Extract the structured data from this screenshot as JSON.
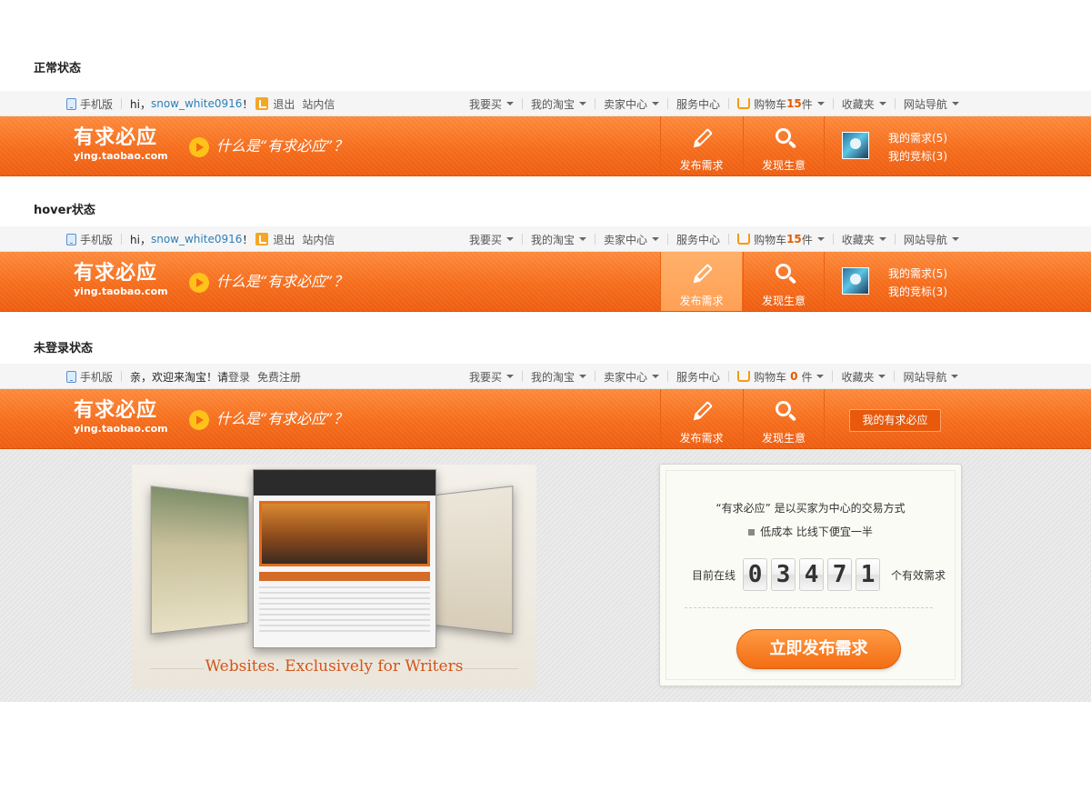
{
  "labels": {
    "normal": "正常状态",
    "hover": "hover状态",
    "logged_out": "未登录状态"
  },
  "topbar": {
    "mobile": "手机版",
    "hi": "hi，",
    "username": "snow_white0916",
    "exclaim": "！",
    "logout": "退出",
    "inbox": "站内信",
    "guest_greeting": "亲，欢迎来淘宝！请",
    "login": "登录",
    "register": "免费注册",
    "buy": "我要买",
    "my_taobao": "我的淘宝",
    "seller_center": "卖家中心",
    "service_center": "服务中心",
    "cart_prefix": "购物车",
    "cart_count_logged_in": "15",
    "cart_count_guest": "0",
    "cart_suffix": "件",
    "favorites": "收藏夹",
    "site_nav": "网站导航"
  },
  "banner": {
    "logo_zh": "有求必应",
    "logo_en": "ying.taobao.com",
    "slogan": "什么是“有求必应”？",
    "publish": "发布需求",
    "discover": "发现生意",
    "my_requests": "我的需求(5)",
    "my_bids": "我的竞标(3)",
    "my_button": "我的有求必应"
  },
  "promo": {
    "caption": "Websites. Exclusively for Writers",
    "intro": "“有求必应” 是以买家为中心的交易方式",
    "benefit": "低成本 比线下便宜一半",
    "online_prefix": "目前在线",
    "digits": [
      "0",
      "3",
      "4",
      "7",
      "1"
    ],
    "online_suffix": "个有效需求",
    "cta": "立即发布需求"
  },
  "colors": {
    "brand_orange": "#f86e1c",
    "username_blue": "#2d7fb8",
    "cart_count": "#e45a00"
  },
  "icons": [
    "phone-icon",
    "weibo-icon",
    "cart-icon",
    "play-icon",
    "pencil-icon",
    "magnifier-icon",
    "speaker-icon",
    "caret-down-icon"
  ]
}
